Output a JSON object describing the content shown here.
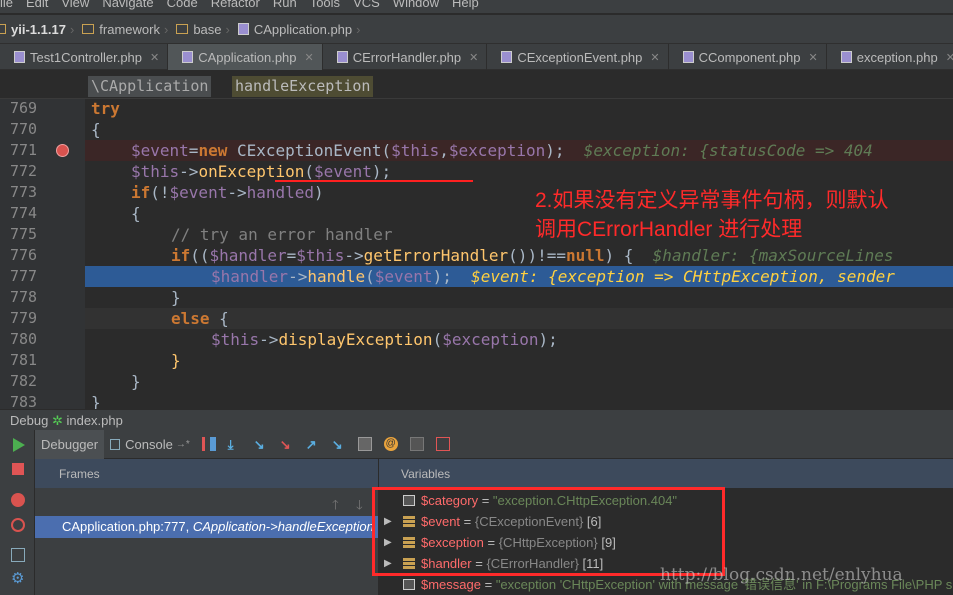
{
  "menu": [
    "File",
    "Edit",
    "View",
    "Navigate",
    "Code",
    "Refactor",
    "Run",
    "Tools",
    "VCS",
    "Window",
    "Help"
  ],
  "breadcrumb": [
    {
      "label": "yii-1.1.17",
      "icon": "folder-icon",
      "bold": true
    },
    {
      "label": "framework",
      "icon": "folder-icon"
    },
    {
      "label": "base",
      "icon": "folder-icon"
    },
    {
      "label": "CApplication.php",
      "icon": "php-file-icon"
    }
  ],
  "tabs": [
    {
      "label": "Test1Controller.php"
    },
    {
      "label": "CApplication.php",
      "active": true
    },
    {
      "label": "CErrorHandler.php"
    },
    {
      "label": "CExceptionEvent.php"
    },
    {
      "label": "CComponent.php"
    },
    {
      "label": "exception.php"
    }
  ],
  "nav": {
    "class": "\\CApplication",
    "method": "handleException"
  },
  "editor": {
    "lines": [
      {
        "n": "769",
        "indent": 2,
        "tokens": [
          [
            "try",
            "kw"
          ]
        ]
      },
      {
        "n": "770",
        "indent": 2,
        "tokens": [
          [
            "{",
            "pl"
          ]
        ]
      },
      {
        "n": "771",
        "indent": 3,
        "bp": true,
        "tokens": [
          [
            "$event",
            "var"
          ],
          [
            "=",
            "pl"
          ],
          [
            "new ",
            "kw"
          ],
          [
            "CExceptionEvent(",
            "pl"
          ],
          [
            "$this",
            "var"
          ],
          [
            ",",
            "pl"
          ],
          [
            "$exception",
            "var"
          ],
          [
            ");  ",
            "pl"
          ],
          [
            "$exception: {statusCode => 404",
            "hint"
          ]
        ]
      },
      {
        "n": "772",
        "indent": 3,
        "tokens": [
          [
            "$this",
            "var"
          ],
          [
            "->",
            "pl"
          ],
          [
            "onException",
            "fn"
          ],
          [
            "(",
            "pl"
          ],
          [
            "$event",
            "var"
          ],
          [
            ");",
            "pl"
          ]
        ]
      },
      {
        "n": "773",
        "indent": 3,
        "tokens": [
          [
            "if",
            "kw"
          ],
          [
            "(!",
            "pl"
          ],
          [
            "$event",
            "var"
          ],
          [
            "->",
            "pl"
          ],
          [
            "handled",
            "var"
          ],
          [
            ")",
            "pl"
          ]
        ]
      },
      {
        "n": "774",
        "indent": 3,
        "tokens": [
          [
            "{",
            "pl"
          ]
        ]
      },
      {
        "n": "775",
        "indent": 4,
        "tokens": [
          [
            "// try an error handler",
            "cm"
          ]
        ]
      },
      {
        "n": "776",
        "indent": 4,
        "tokens": [
          [
            "if",
            "kw"
          ],
          [
            "((",
            "pl"
          ],
          [
            "$handler",
            "var"
          ],
          [
            "=",
            "pl"
          ],
          [
            "$this",
            "var"
          ],
          [
            "->",
            "pl"
          ],
          [
            "getErrorHandler",
            "fn"
          ],
          [
            "())!==",
            "pl"
          ],
          [
            "null",
            "kw"
          ],
          [
            ") {  ",
            "pl"
          ],
          [
            "$handler: {maxSourceLines",
            "hint"
          ]
        ]
      },
      {
        "n": "777",
        "indent": 5,
        "exec": true,
        "tokens": [
          [
            "$handler",
            "var"
          ],
          [
            "->",
            "pl"
          ],
          [
            "handle",
            "fn"
          ],
          [
            "(",
            "pl"
          ],
          [
            "$event",
            "var"
          ],
          [
            ");  ",
            "pl"
          ],
          [
            "$event: {exception => CHttpException, sender",
            "hintx"
          ]
        ]
      },
      {
        "n": "778",
        "indent": 4,
        "tokens": [
          [
            "}",
            "pl"
          ]
        ]
      },
      {
        "n": "779",
        "indent": 4,
        "cur": true,
        "tokens": [
          [
            "else ",
            "kw"
          ],
          [
            "{",
            "pl"
          ]
        ]
      },
      {
        "n": "780",
        "indent": 5,
        "tokens": [
          [
            "$this",
            "var"
          ],
          [
            "->",
            "pl"
          ],
          [
            "displayException",
            "fn"
          ],
          [
            "(",
            "pl"
          ],
          [
            "$exception",
            "var"
          ],
          [
            ");",
            "pl"
          ]
        ]
      },
      {
        "n": "781",
        "indent": 4,
        "tokens": [
          [
            "}",
            "fn"
          ]
        ]
      },
      {
        "n": "782",
        "indent": 3,
        "tokens": [
          [
            "}",
            "pl"
          ]
        ]
      },
      {
        "n": "783",
        "indent": 2,
        "tokens": [
          [
            "}",
            "pl"
          ]
        ]
      }
    ]
  },
  "annotation": {
    "line1": "2.如果没有定义异常事件句柄，则默认",
    "line2": "调用CErrorHandler 进行处理",
    "color": "#ff2a2a"
  },
  "debug": {
    "title_prefix": "Debug",
    "title_config": "index.php",
    "tabs": [
      "Debugger",
      "Console"
    ],
    "frames_label": "Frames",
    "variables_label": "Variables",
    "frame": {
      "location": "CApplication.php:777, ",
      "method": "CApplication->handleException"
    },
    "variables": [
      {
        "name": "$category",
        "eq": " = ",
        "value": "\"exception.CHttpException.404\"",
        "type": "string",
        "expandable": false
      },
      {
        "name": "$event",
        "eq": " = ",
        "value": "{CExceptionEvent}",
        "count": " [6]",
        "type": "object",
        "expandable": true
      },
      {
        "name": "$exception",
        "eq": " = ",
        "value": "{CHttpException}",
        "count": " [9]",
        "type": "object",
        "expandable": true
      },
      {
        "name": "$handler",
        "eq": " = ",
        "value": "{CErrorHandler}",
        "count": " [11]",
        "type": "object",
        "expandable": true
      },
      {
        "name": "$message",
        "eq": " = ",
        "value": "\"exception 'CHttpException' with message '错误信息' in F:\\Programs File\\PHP su",
        "type": "string",
        "expandable": false
      }
    ]
  },
  "watermark": "http://blog.csdn.net/enlyhua"
}
